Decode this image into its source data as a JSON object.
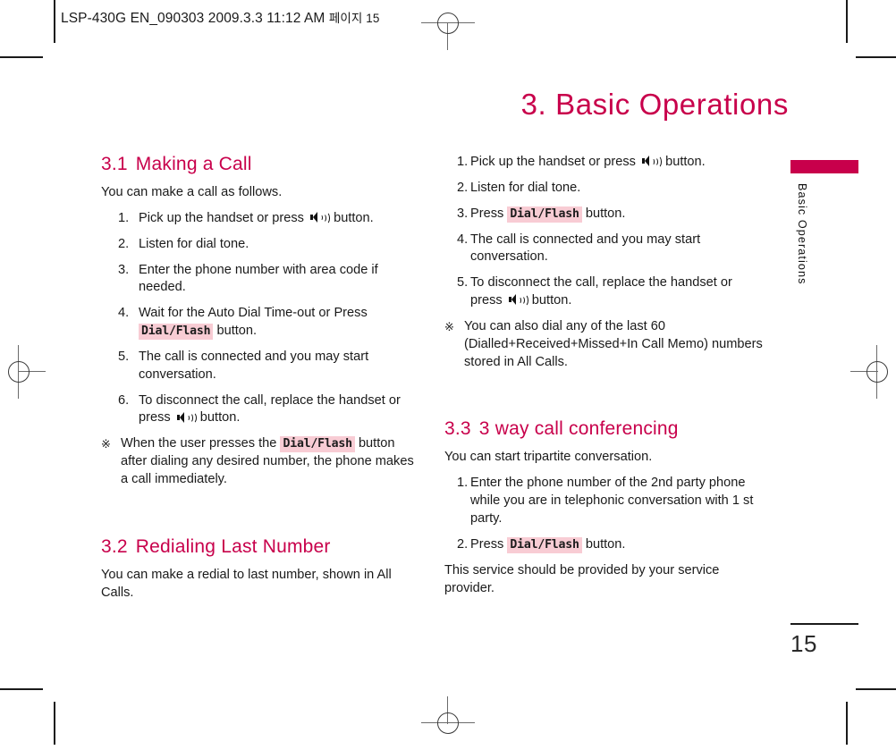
{
  "header": {
    "slug_main": "LSP-430G EN_090303  2009.3.3 11:12 AM",
    "slug_korean": "페이지 15"
  },
  "page": {
    "title": "3. Basic Operations",
    "folio": "15",
    "tab_label": "Basic Operations",
    "accent_color": "#c8004b",
    "key_highlight_color": "#f8ccd4"
  },
  "icons": {
    "speaker": "speaker-icon",
    "note_mark": "※"
  },
  "left_column": {
    "section_3_1": {
      "number": "3.1",
      "title": "Making a Call",
      "lead": "You can make a call as follows.",
      "steps": [
        {
          "n": "1.",
          "pre": "Pick up the handset or press",
          "icon": "speaker",
          "post": "button."
        },
        {
          "n": "2.",
          "pre": "Listen for dial tone.",
          "icon": "",
          "post": ""
        },
        {
          "n": "3.",
          "pre": "Enter the phone number with area code if needed.",
          "icon": "",
          "post": ""
        },
        {
          "n": "4.",
          "pre": "Wait for the Auto Dial Time-out or Press",
          "key": "Dial/Flash",
          "post": "button."
        },
        {
          "n": "5.",
          "pre": "The call is connected and you may start conversation.",
          "icon": "",
          "post": ""
        },
        {
          "n": "6.",
          "pre": "To disconnect the call, replace the handset or press",
          "icon": "speaker",
          "post": "button."
        }
      ],
      "note_pre": "When the user presses the",
      "note_key": "Dial/Flash",
      "note_post": "button after dialing any desired number, the phone makes a call immediately."
    },
    "section_3_2": {
      "number": "3.2",
      "title": "Redialing Last Number",
      "lead": "You can make a redial to last number, shown in All Calls."
    }
  },
  "right_column": {
    "section_3_2_steps": [
      {
        "n": "1.",
        "pre": "Pick up the handset or press",
        "icon": "speaker",
        "post": "button."
      },
      {
        "n": "2.",
        "pre": "Listen for dial tone.",
        "icon": "",
        "post": ""
      },
      {
        "n": "3.",
        "pre": "Press",
        "key": "Dial/Flash",
        "post": "button."
      },
      {
        "n": "4.",
        "pre": "The call is connected and you may start conversation.",
        "icon": "",
        "post": ""
      },
      {
        "n": "5.",
        "pre": "To disconnect the call, replace the handset or press",
        "icon": "speaker",
        "post": "button."
      }
    ],
    "note": "You can also dial any of the last 60 (Dialled+Received+Missed+In Call Memo) numbers stored in All Calls.",
    "section_3_3": {
      "number": "3.3",
      "title": "3 way call conferencing",
      "lead": "You can start tripartite conversation.",
      "steps": [
        {
          "n": "1.",
          "pre": "Enter the phone number of the 2nd party phone while you are in telephonic conversation with 1 st party.",
          "icon": "",
          "post": ""
        },
        {
          "n": "2.",
          "pre": "Press",
          "key": "Dial/Flash",
          "post": "button."
        }
      ],
      "closing": "This service should be provided by your service provider."
    }
  }
}
